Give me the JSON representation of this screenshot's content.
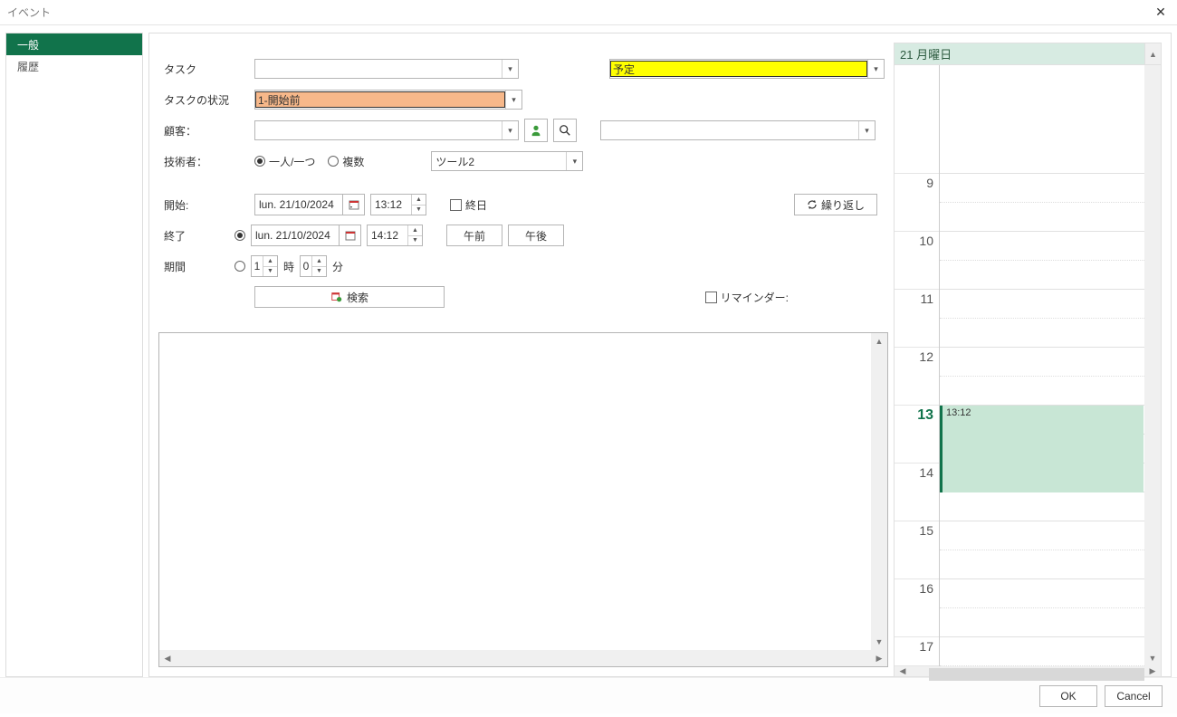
{
  "window": {
    "title": "イベント"
  },
  "sidebar": {
    "tabs": [
      {
        "label": "一般",
        "active": true
      },
      {
        "label": "履歴",
        "active": false
      }
    ]
  },
  "form": {
    "task": {
      "label": "タスク"
    },
    "category": {
      "value": "予定"
    },
    "task_status": {
      "label": "タスクの状況",
      "value": "1-開始前"
    },
    "customer": {
      "label": "顧客："
    },
    "technician": {
      "label": "技術者：",
      "mode_single": "一人/一つ",
      "mode_multiple": "複数",
      "tool_value": "ツール2"
    },
    "start": {
      "label": "開始:",
      "date": "lun. 21/10/2024",
      "time": "13:12"
    },
    "allday": {
      "label": "終日"
    },
    "recur": {
      "label": "繰り返し"
    },
    "end": {
      "label": "終了",
      "date": "lun. 21/10/2024",
      "time": "14:12",
      "am": "午前",
      "pm": "午後"
    },
    "duration": {
      "label": "期間",
      "hours": "1",
      "hours_unit": "時",
      "minutes": "0",
      "minutes_unit": "分"
    },
    "search": {
      "label": "検索"
    },
    "reminder": {
      "label": "リマインダー:"
    }
  },
  "calendar": {
    "day_number": "21",
    "day_name": "月曜日",
    "hours": [
      "9",
      "10",
      "11",
      "12",
      "13",
      "14",
      "15",
      "16",
      "17"
    ],
    "event": {
      "time": "13:12"
    }
  },
  "footer": {
    "ok": "OK",
    "cancel": "Cancel"
  }
}
